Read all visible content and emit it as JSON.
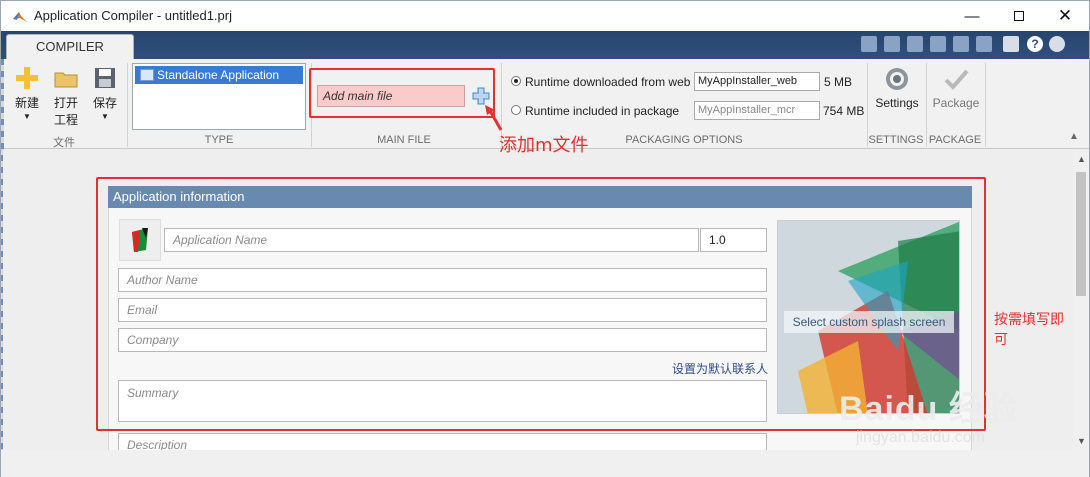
{
  "window": {
    "title": "Application Compiler - untitled1.prj"
  },
  "tab": {
    "label": "COMPILER"
  },
  "ribbon": {
    "file_group": {
      "new_label": "新建",
      "open_label_line1": "打开",
      "open_label_line2": "工程",
      "save_label": "保存",
      "section": "文件"
    },
    "type_group": {
      "item": "Standalone Application",
      "section": "TYPE"
    },
    "mainfile_group": {
      "placeholder": "Add main file",
      "section": "MAIN FILE"
    },
    "packaging": {
      "web_label": "Runtime downloaded from web",
      "web_value": "MyAppInstaller_web",
      "web_size": "5 MB",
      "pkg_label": "Runtime included in package",
      "pkg_value": "MyAppInstaller_mcr",
      "pkg_size": "754 MB",
      "section": "PACKAGING OPTIONS"
    },
    "settings": {
      "label": "Settings",
      "section": "SETTINGS"
    },
    "package": {
      "label": "Package",
      "section": "PACKAGE"
    }
  },
  "app_info": {
    "header": "Application information",
    "name_placeholder": "Application Name",
    "version": "1.0",
    "author_placeholder": "Author Name",
    "email_placeholder": "Email",
    "company_placeholder": "Company",
    "default_contact_link": "设置为默认联系人",
    "summary_placeholder": "Summary",
    "description_placeholder": "Description",
    "splash_label": "Select custom splash screen"
  },
  "annotations": {
    "add_m_file": "添加m文件",
    "fill_as_needed_line1": "按需填写即",
    "fill_as_needed_line2": "可"
  },
  "watermark": {
    "brand": "Baidu 经验",
    "url": "jingyan.baidu.com"
  },
  "colors": {
    "accent": "#3a7ad3",
    "annotation": "#e53030",
    "panel_header": "#6889b0",
    "strip": "#2f4f7d"
  }
}
